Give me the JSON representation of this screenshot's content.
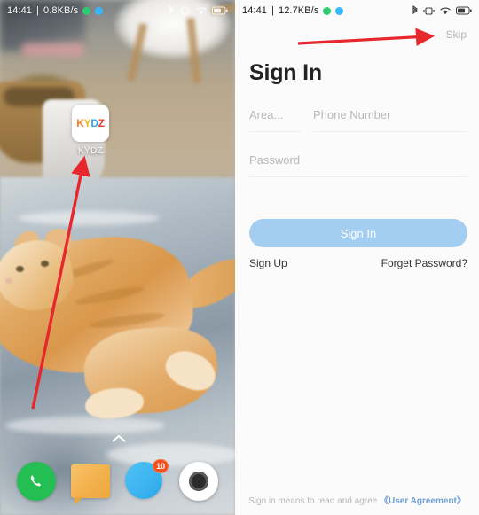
{
  "left_panel": {
    "status_bar": {
      "time": "14:41",
      "separator": "|",
      "net_speed": "0.8KB/s",
      "icons": [
        "bluetooth-icon",
        "vibrate-icon",
        "wifi-icon",
        "battery-icon"
      ]
    },
    "app_icon": {
      "name": "KYDZ",
      "label": "KYDZ",
      "letters": [
        "K",
        "Y",
        "D",
        "Z"
      ],
      "letter_colors": [
        "#f07c2a",
        "#f2b516",
        "#3aa6dd",
        "#e8422e"
      ]
    },
    "annotation": {
      "type": "red-arrow",
      "color": "#e8272c",
      "points_to": "KYDZ"
    },
    "dock": [
      {
        "name": "phone",
        "badge": ""
      },
      {
        "name": "messages",
        "badge": ""
      },
      {
        "name": "browser",
        "badge": "10"
      },
      {
        "name": "camera",
        "badge": ""
      }
    ],
    "drawer_handle": "chevron-up-icon"
  },
  "right_panel": {
    "status_bar": {
      "time": "14:41",
      "separator": "|",
      "net_speed": "12.7KB/s",
      "icons": [
        "bluetooth-icon",
        "vibrate-icon",
        "wifi-icon",
        "battery-icon"
      ]
    },
    "skip_label": "Skip",
    "title": "Sign In",
    "annotation": {
      "type": "red-arrow",
      "color": "#e8272c",
      "points_to": "Skip"
    },
    "fields": {
      "area_placeholder": "Area...",
      "area_value": "",
      "phone_placeholder": "Phone Number",
      "phone_value": "",
      "password_placeholder": "Password",
      "password_value": ""
    },
    "sign_in_button": {
      "label": "Sign In",
      "color": "#a4cdf2",
      "text_color": "#ffffff"
    },
    "sign_up_label": "Sign Up",
    "forget_password_label": "Forget Password?",
    "agreement": {
      "prefix": "Sign in means to read and agree",
      "link": "《User Agreement》",
      "link_color": "#6f9fd8"
    }
  }
}
